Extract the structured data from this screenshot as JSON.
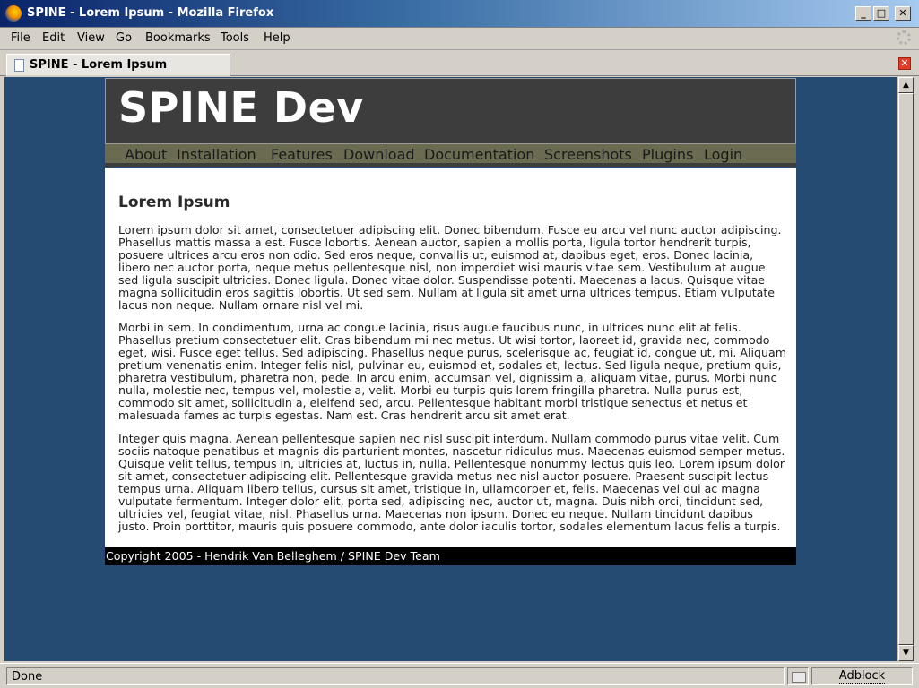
{
  "window": {
    "title": "SPINE - Lorem Ipsum - Mozilla Firefox",
    "minimize": "_",
    "maximize": "□",
    "close": "✕"
  },
  "menu": [
    {
      "label": "File"
    },
    {
      "label": "Edit"
    },
    {
      "label": "View"
    },
    {
      "label": "Go"
    },
    {
      "label": "Bookmarks"
    },
    {
      "label": "Tools"
    },
    {
      "label": "Help"
    }
  ],
  "tab": {
    "label": "SPINE - Lorem Ipsum",
    "close": "✕"
  },
  "site": {
    "title": "SPINE Dev",
    "nav": [
      "About",
      "Installation",
      "Features",
      "Download",
      "Documentation",
      "Screenshots",
      "Plugins",
      "Login"
    ],
    "heading": "Lorem Ipsum",
    "paragraphs": [
      "Lorem ipsum dolor sit amet, consectetuer adipiscing elit. Donec bibendum. Fusce eu arcu vel nunc auctor adipiscing. Phasellus mattis massa a est. Fusce lobortis. Aenean auctor, sapien a mollis porta, ligula tortor hendrerit turpis, posuere ultrices arcu eros non odio. Sed eros neque, convallis ut, euismod at, dapibus eget, eros. Donec lacinia, libero nec auctor porta, neque metus pellentesque nisl, non imperdiet wisi mauris vitae sem. Vestibulum at augue sed ligula suscipit ultricies. Donec ligula. Donec vitae dolor. Suspendisse potenti. Maecenas a lacus. Quisque vitae magna sollicitudin eros sagittis lobortis. Ut sed sem. Nullam at ligula sit amet urna ultrices tempus. Etiam vulputate lacus non neque. Nullam ornare nisl vel mi.",
      "Morbi in sem. In condimentum, urna ac congue lacinia, risus augue faucibus nunc, in ultrices nunc elit at felis. Phasellus pretium consectetuer elit. Cras bibendum mi nec metus. Ut wisi tortor, laoreet id, gravida nec, commodo eget, wisi. Fusce eget tellus. Sed adipiscing. Phasellus neque purus, scelerisque ac, feugiat id, congue ut, mi. Aliquam pretium venenatis enim. Integer felis nisl, pulvinar eu, euismod et, sodales et, lectus. Sed ligula neque, pretium quis, pharetra vestibulum, pharetra non, pede. In arcu enim, accumsan vel, dignissim a, aliquam vitae, purus. Morbi nunc nulla, molestie nec, tempus vel, molestie a, velit. Morbi eu turpis quis lorem fringilla pharetra. Nulla purus est, commodo sit amet, sollicitudin a, eleifend sed, arcu. Pellentesque habitant morbi tristique senectus et netus et malesuada fames ac turpis egestas. Nam est. Cras hendrerit arcu sit amet erat.",
      "Integer quis magna. Aenean pellentesque sapien nec nisl suscipit interdum. Nullam commodo purus vitae velit. Cum sociis natoque penatibus et magnis dis parturient montes, nascetur ridiculus mus. Maecenas euismod semper metus. Quisque velit tellus, tempus in, ultricies at, luctus in, nulla. Pellentesque nonummy lectus quis leo. Lorem ipsum dolor sit amet, consectetuer adipiscing elit. Pellentesque gravida metus nec nisl auctor posuere. Praesent suscipit lectus tempus urna. Aliquam libero tellus, cursus sit amet, tristique in, ullamcorper et, felis. Maecenas vel dui ac magna vulputate fermentum. Integer dolor elit, porta sed, adipiscing nec, auctor ut, magna. Duis nibh orci, tincidunt sed, ultricies vel, feugiat vitae, nisl. Phasellus urna. Maecenas non ipsum. Donec eu neque. Nullam tincidunt dapibus justo. Proin porttitor, mauris quis posuere commodo, ante dolor iaculis tortor, sodales elementum lacus felis a turpis."
    ],
    "footer": "Copyright 2005 - Hendrik Van Belleghem / SPINE Dev Team"
  },
  "status": {
    "text": "Done",
    "adblock": "Adblock"
  },
  "colors": {
    "page_background": "#254b72",
    "header": "#3d3d3d",
    "navbar": "#6b6b52",
    "footer": "#000000"
  },
  "icons": [
    "firefox-icon",
    "throbber-icon",
    "page-icon",
    "close-tab-icon",
    "mail-icon"
  ]
}
